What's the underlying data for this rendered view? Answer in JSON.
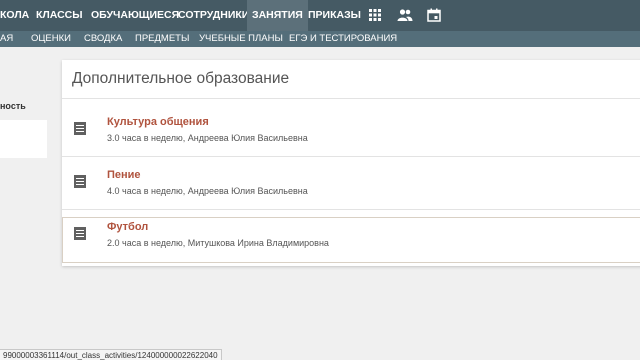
{
  "top_nav": {
    "items": [
      "КОЛА",
      "КЛАССЫ",
      "ОБУЧАЮЩИЕСЯ",
      "СОТРУДНИКИ",
      "ЗАНЯТИЯ",
      "ПРИКАЗЫ"
    ],
    "active": "ЗАНЯТИЯ",
    "icons": [
      "grid-icon",
      "people-icon",
      "calendar-icon"
    ]
  },
  "sub_nav": {
    "items": [
      "АЯ",
      "ОЦЕНКИ",
      "СВОДКА",
      "ПРЕДМЕТЫ",
      "УЧЕБНЫЕ ПЛАНЫ",
      "ЕГЭ И ТЕСТИРОВАНИЯ"
    ]
  },
  "sidebar": {
    "label": "ность"
  },
  "main": {
    "title": "Дополнительное образование",
    "activities": [
      {
        "name": "Культура общения",
        "meta": "3.0 часа в неделю, Андреева Юлия Васильевна",
        "icon": "document-icon"
      },
      {
        "name": "Пение",
        "meta": "4.0 часа в неделю, Андреева Юлия Васильевна",
        "icon": "document-icon"
      },
      {
        "name": "Футбол",
        "meta": "2.0 часа в неделю, Митушкова Ирина Владимировна",
        "icon": "document-icon"
      }
    ]
  },
  "status_bar": {
    "url": "99000003361114/out_class_activities/124000000022622040"
  },
  "colors": {
    "top_nav_bg": "#455a64",
    "sub_nav_bg": "#546e7a",
    "activity_name": "#b0533e"
  }
}
